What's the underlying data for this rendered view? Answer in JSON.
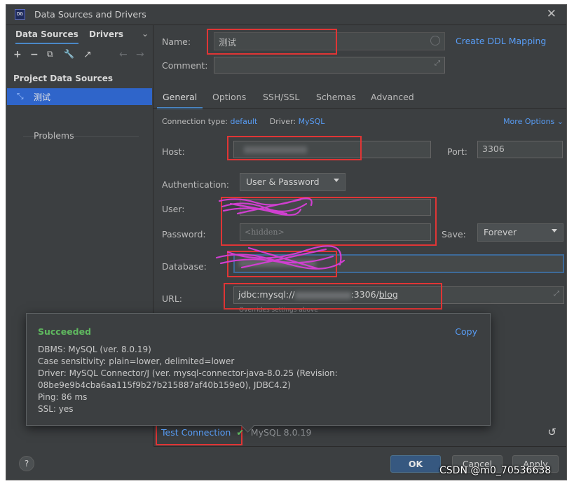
{
  "window": {
    "app_icon": "DG",
    "title": "Data Sources and Drivers",
    "close": "✕"
  },
  "sidebar": {
    "tabs": [
      "Data Sources",
      "Drivers"
    ],
    "toolbar": {
      "add": "+",
      "remove": "−",
      "copy": "⧉",
      "settings": "🔧",
      "navigate": "↗",
      "back": "←",
      "forward": "→"
    },
    "section": "Project Data Sources",
    "selected_item": "测试",
    "problems": "Problems"
  },
  "form": {
    "name_label": "Name:",
    "name_value": "测试",
    "create_ddl": "Create DDL Mapping",
    "comment_label": "Comment:",
    "tabs": [
      "General",
      "Options",
      "SSH/SSL",
      "Schemas",
      "Advanced"
    ],
    "conn_type_label": "Connection type:",
    "conn_type_value": "default",
    "driver_label": "Driver:",
    "driver_value": "MySQL",
    "more_options": "More Options",
    "host_label": "Host:",
    "port_label": "Port:",
    "port_value": "3306",
    "auth_label": "Authentication:",
    "auth_value": "User & Password",
    "user_label": "User:",
    "password_label": "Password:",
    "password_placeholder": "<hidden>",
    "save_label": "Save:",
    "save_value": "Forever",
    "database_label": "Database:",
    "url_label": "URL:",
    "url_prefix": "jdbc:mysql://",
    "url_port": ":3306/",
    "url_db": "blog",
    "overrides_note": "Overrides settings above"
  },
  "popup": {
    "status": "Succeeded",
    "copy": "Copy",
    "lines": [
      "DBMS: MySQL (ver. 8.0.19)",
      "Case sensitivity: plain=lower, delimited=lower",
      "Driver: MySQL Connector/J (ver. mysql-connector-java-8.0.25 (Revision:",
      "08be9e9b4cba6aa115f9b27b215887af40b159e0), JDBC4.2)",
      "Ping: 86 ms",
      "SSL: yes"
    ]
  },
  "test_bar": {
    "test_connection": "Test Connection",
    "check": "✔",
    "version": "MySQL 8.0.19",
    "reset": "↺"
  },
  "footer": {
    "help": "?",
    "ok": "OK",
    "cancel": "Cancel",
    "apply": "Apply"
  },
  "watermark": "CSDN @m0_70536638",
  "colors": {
    "accent": "#4a88c7",
    "link": "#589df6",
    "success": "#5fb85f",
    "highlight_box": "#e03535",
    "selection": "#2f65ca"
  }
}
